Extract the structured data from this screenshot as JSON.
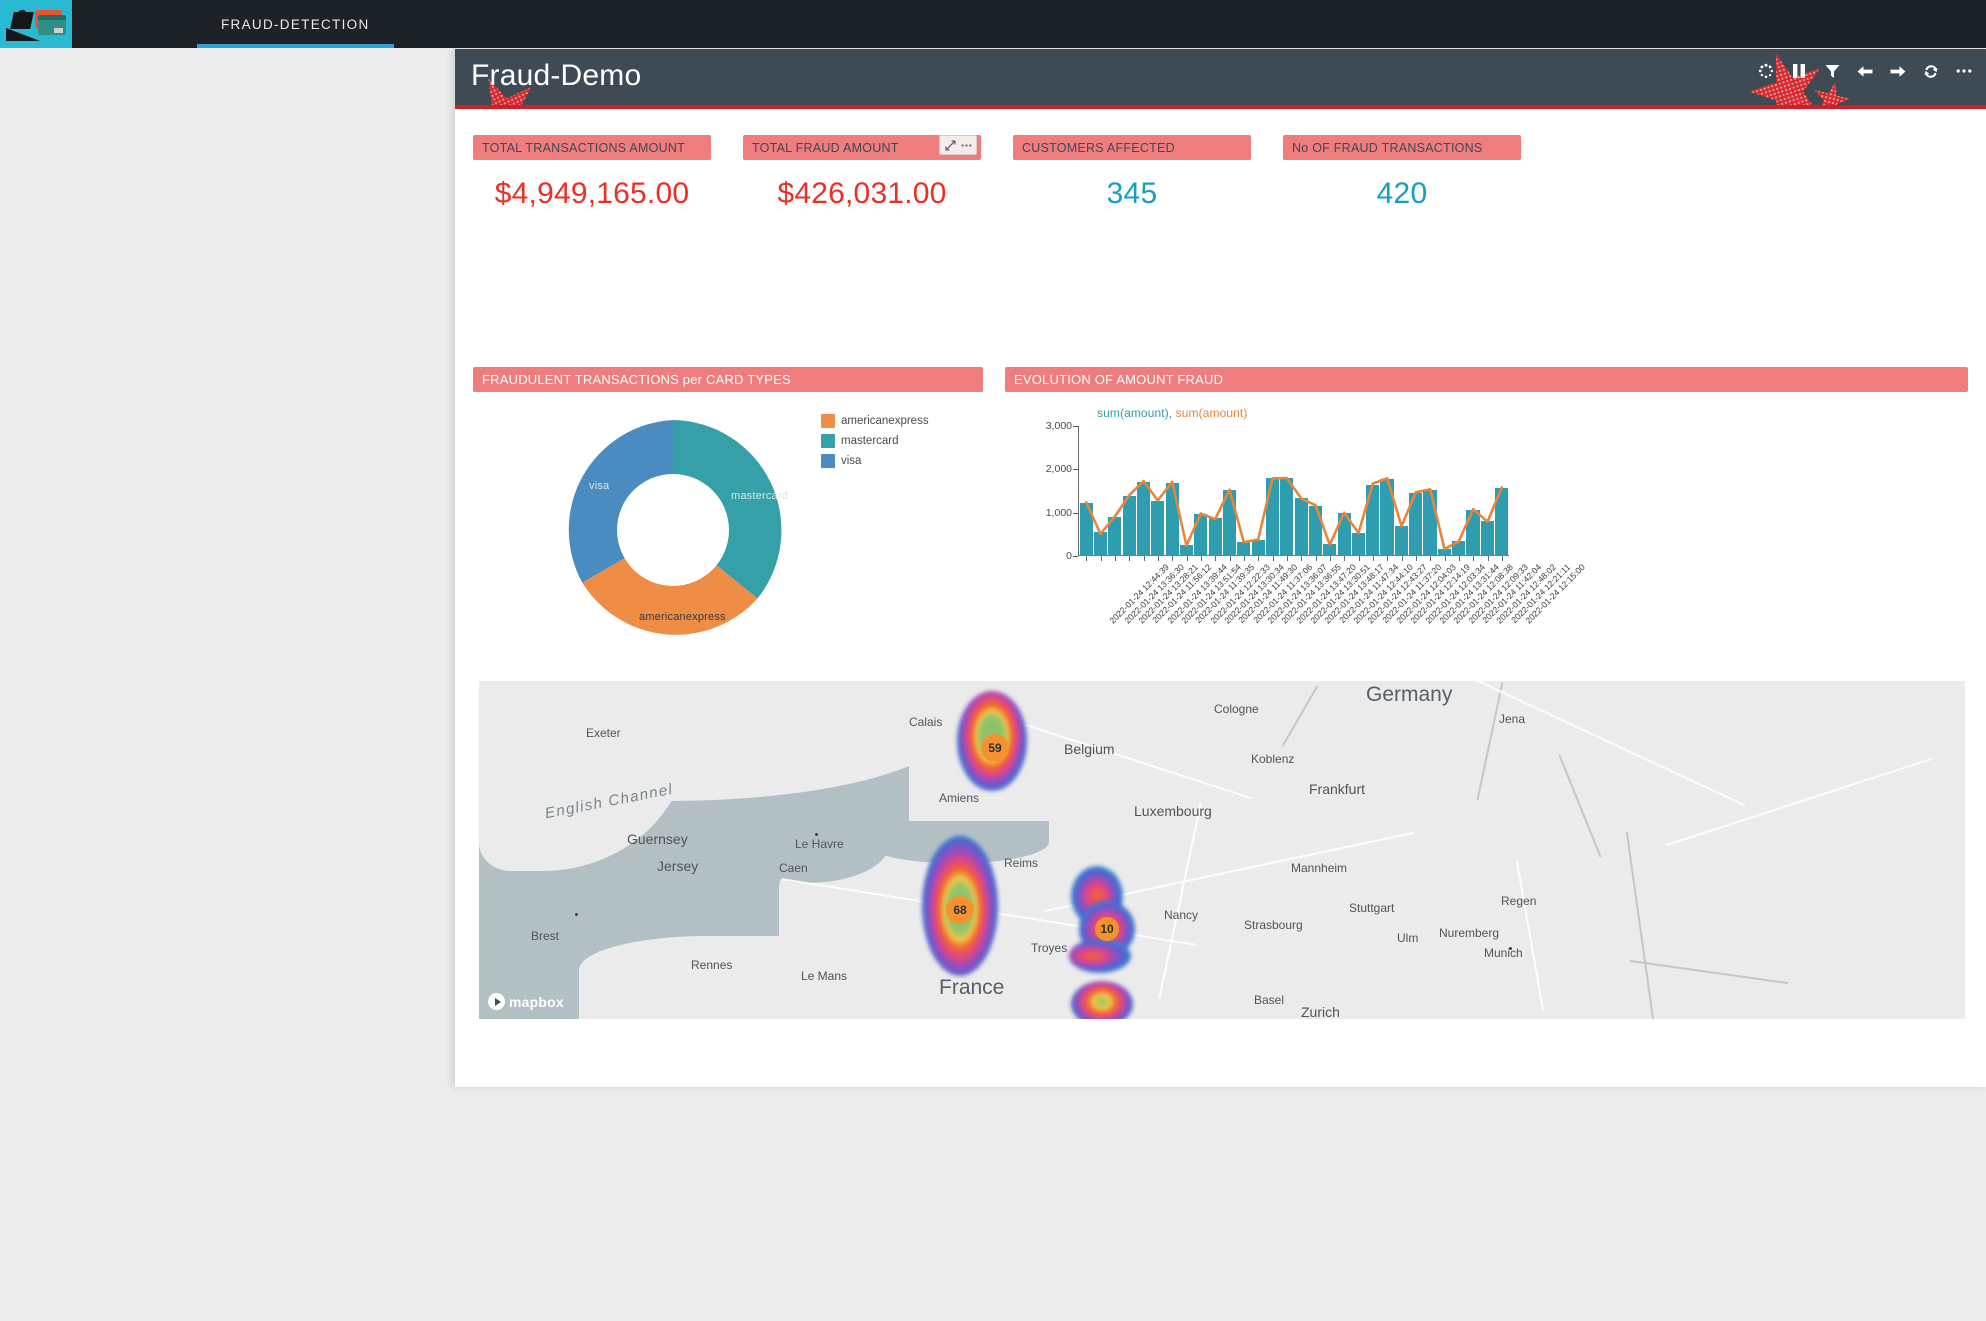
{
  "topnav": {
    "logo_name": "fraud-detection-logo",
    "tabs": [
      {
        "label": "FRAUD-DETECTION",
        "active": true
      }
    ]
  },
  "dashboard": {
    "title": "Fraud-Demo",
    "accent_color": "#cc2127",
    "header_bg": "#3e4b55",
    "panel_header_color": "#f07d7d",
    "toolbar": [
      {
        "name": "loading-spinner-icon",
        "label": "Loading"
      },
      {
        "name": "pause-icon",
        "label": "Pause"
      },
      {
        "name": "filter-icon",
        "label": "Filter"
      },
      {
        "name": "back-arrow-icon",
        "label": "Back"
      },
      {
        "name": "forward-arrow-icon",
        "label": "Forward"
      },
      {
        "name": "refresh-icon",
        "label": "Refresh"
      },
      {
        "name": "more-options-icon",
        "label": "More"
      }
    ]
  },
  "kpis": [
    {
      "title": "TOTAL TRANSACTIONS AMOUNT",
      "value": "$4,949,165.00",
      "color": "red",
      "has_controls": false
    },
    {
      "title": "TOTAL FRAUD AMOUNT",
      "value": "$426,031.00",
      "color": "red",
      "has_controls": true,
      "controls": [
        {
          "name": "expand-icon",
          "glyph": "↗"
        },
        {
          "name": "menu-icon",
          "glyph": "⋯"
        }
      ]
    },
    {
      "title": "CUSTOMERS AFFECTED",
      "value": "345",
      "color": "teal",
      "has_controls": false
    },
    {
      "title": "No OF FRAUD TRANSACTIONS",
      "value": "420",
      "color": "teal",
      "has_controls": false
    }
  ],
  "panels": {
    "donut_title": "FRAUDULENT TRANSACTIONS per CARD TYPES",
    "bar_title": "EVOLUTION OF AMOUNT FRAUD"
  },
  "chart_data": [
    {
      "type": "pie",
      "title": "FRAUDULENT TRANSACTIONS per CARD TYPES",
      "variant": "donut",
      "categories": [
        "mastercard",
        "americanexpress",
        "visa"
      ],
      "values": [
        36,
        32,
        32
      ],
      "colors": [
        "#35a0a7",
        "#ef8c46",
        "#4a8cc0"
      ],
      "legend": [
        {
          "label": "americanexpress",
          "color": "#ef8c46"
        },
        {
          "label": "mastercard",
          "color": "#35a0a7"
        },
        {
          "label": "visa",
          "color": "#4a8cc0"
        }
      ],
      "legend_position": "right",
      "slice_labels": [
        "visa",
        "mastercard",
        "americanexpress"
      ]
    },
    {
      "type": "bar",
      "title": "EVOLUTION OF AMOUNT FRAUD",
      "legend_text": "sum(amount), sum(amount)",
      "legend": [
        {
          "label": "sum(amount)",
          "color": "#2e9db0",
          "kind": "bar"
        },
        {
          "label": "sum(amount)",
          "color": "#e8853d",
          "kind": "line"
        }
      ],
      "ylabel": "",
      "xlabel": "",
      "ylim": [
        0,
        3000
      ],
      "yticks": [
        0,
        1000,
        2000,
        3000
      ],
      "ytick_labels": [
        "0",
        "1,000",
        "2,000",
        "3,000"
      ],
      "grid": false,
      "categories": [
        "2022-01-24 12:44:39",
        "2022-01-24 13:36:30",
        "2022-01-24 13:28:21",
        "2022-01-24 11:56:12",
        "2022-01-24 13:39:44",
        "2022-01-24 13:51:54",
        "2022-01-24 11:39:35",
        "2022-01-24 12:22:33",
        "2022-01-24 13:30:34",
        "2022-01-24 11:49:30",
        "2022-01-24 11:37:06",
        "2022-01-24 13:36:07",
        "2022-01-24 13:36:55",
        "2022-01-24 13:47:20",
        "2022-01-24 13:30:51",
        "2022-01-24 13:48:17",
        "2022-01-24 11:47:34",
        "2022-01-24 12:44:10",
        "2022-01-24 12:43:27",
        "2022-01-24 11:37:20",
        "2022-01-24 12:04:03",
        "2022-01-24 12:14:19",
        "2022-01-24 12:03:34",
        "2022-01-24 13:31:44",
        "2022-01-24 12:08:38",
        "2022-01-24 12:09:33",
        "2022-01-24 11:42:04",
        "2022-01-24 12:48:02",
        "2022-01-24 12:21:11",
        "2022-01-24 12:15:00"
      ],
      "series": [
        {
          "name": "sum(amount)",
          "kind": "bar",
          "color": "#2e9db0",
          "values": [
            1230,
            560,
            900,
            1380,
            1700,
            1280,
            1690,
            250,
            980,
            880,
            1520,
            330,
            370,
            1790,
            1800,
            1350,
            1160,
            280,
            990,
            540,
            1650,
            1780,
            700,
            1450,
            1530,
            170,
            350,
            1060,
            800,
            1560
          ]
        },
        {
          "name": "sum(amount)",
          "kind": "line",
          "color": "#e8853d",
          "values": [
            1240,
            510,
            910,
            1400,
            1730,
            1280,
            1710,
            240,
            980,
            850,
            1530,
            320,
            380,
            1790,
            1800,
            1330,
            1170,
            260,
            1000,
            530,
            1670,
            1790,
            690,
            1470,
            1540,
            160,
            340,
            1080,
            790,
            1580
          ]
        }
      ]
    }
  ],
  "map": {
    "attribution": "mapbox",
    "clusters": [
      {
        "label": "59"
      },
      {
        "label": "68"
      },
      {
        "label": "10"
      }
    ],
    "labels": [
      {
        "text": "Exeter",
        "size": "sm"
      },
      {
        "text": "Calais",
        "size": "sm"
      },
      {
        "text": "Belgium",
        "size": "med"
      },
      {
        "text": "Germany",
        "size": "big"
      },
      {
        "text": "Cologne",
        "size": "sm"
      },
      {
        "text": "Jena",
        "size": "sm"
      },
      {
        "text": "Koblenz",
        "size": "sm"
      },
      {
        "text": "Frankfurt",
        "size": "med"
      },
      {
        "text": "Amiens",
        "size": "sm"
      },
      {
        "text": "Luxembourg",
        "size": "med"
      },
      {
        "text": "English Channel",
        "size": "chan"
      },
      {
        "text": "Guernsey",
        "size": "med"
      },
      {
        "text": "Jersey",
        "size": "med"
      },
      {
        "text": "Le Havre",
        "size": "sm"
      },
      {
        "text": "Caen",
        "size": "sm"
      },
      {
        "text": "Reims",
        "size": "sm"
      },
      {
        "text": "Mannheim",
        "size": "sm"
      },
      {
        "text": "Nuremberg",
        "size": "sm"
      },
      {
        "text": "Brest",
        "size": "sm"
      },
      {
        "text": "Nancy",
        "size": "sm"
      },
      {
        "text": "Stuttgart",
        "size": "sm"
      },
      {
        "text": "Regen",
        "size": "sm"
      },
      {
        "text": "Troyes",
        "size": "sm"
      },
      {
        "text": "Strasbourg",
        "size": "sm"
      },
      {
        "text": "Ulm",
        "size": "sm"
      },
      {
        "text": "Rennes",
        "size": "sm"
      },
      {
        "text": "Munich",
        "size": "sm"
      },
      {
        "text": "Le Mans",
        "size": "sm"
      },
      {
        "text": "France",
        "size": "big"
      },
      {
        "text": "Basel",
        "size": "sm"
      },
      {
        "text": "Zurich",
        "size": "med"
      }
    ]
  }
}
